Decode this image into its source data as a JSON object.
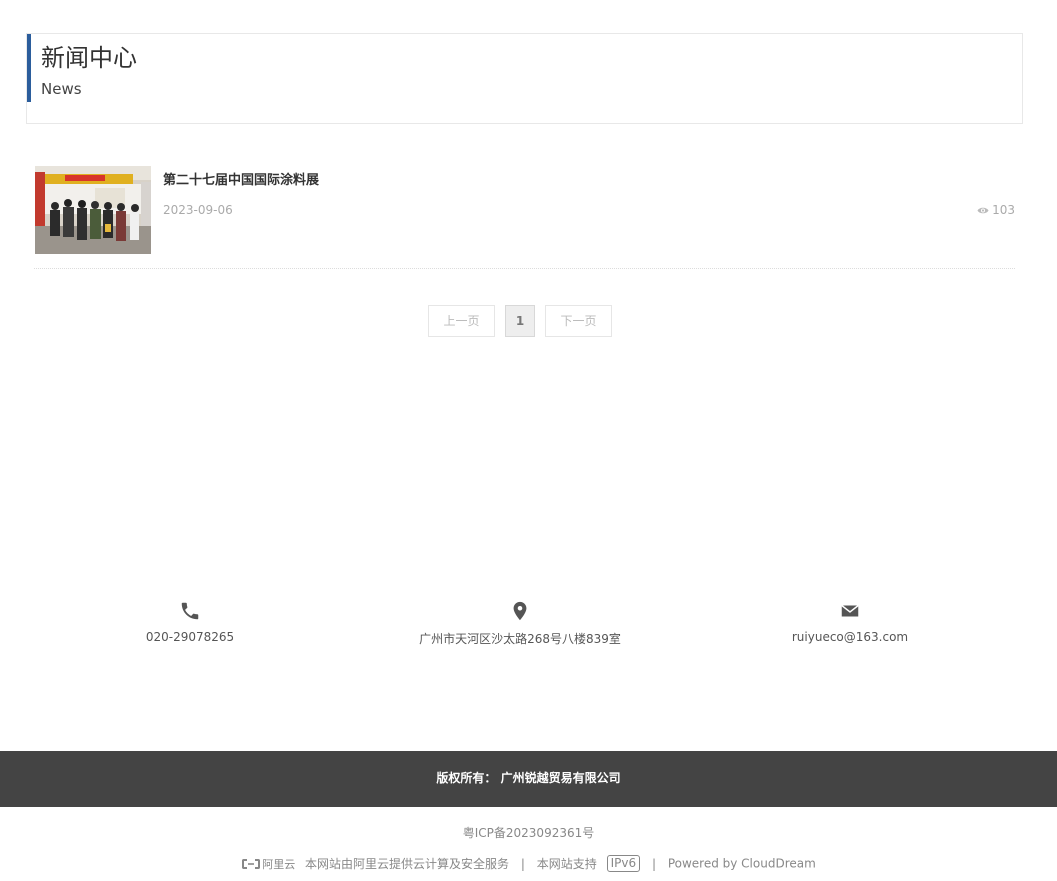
{
  "section": {
    "title_cn": "新闻中心",
    "title_en": "News"
  },
  "news": [
    {
      "title": "第二十七届中国国际涂料展",
      "date": "2023-09-06",
      "views": "103"
    }
  ],
  "pagination": {
    "prev": "上一页",
    "current": "1",
    "next": "下一页"
  },
  "contacts": {
    "phone": "020-29078265",
    "address": "广州市天河区沙太路268号八楼839室",
    "email": "ruiyueco@163.com"
  },
  "footer": {
    "copyright": "版权所有： 广州锐越贸易有限公司",
    "icp": "粤ICP备2023092361号",
    "aliyun_logo": "阿里云",
    "aliyun_text": "本网站由阿里云提供云计算及安全服务",
    "ipv6_text": "本网站支持",
    "ipv6_badge": "IPv6",
    "powered": "Powered by CloudDream"
  },
  "colors": {
    "accent": "#2b5d9c",
    "footer_bg": "#444444"
  },
  "icons": [
    "eye-icon",
    "phone-icon",
    "location-pin-icon",
    "mail-icon",
    "aliyun-logo-icon"
  ]
}
